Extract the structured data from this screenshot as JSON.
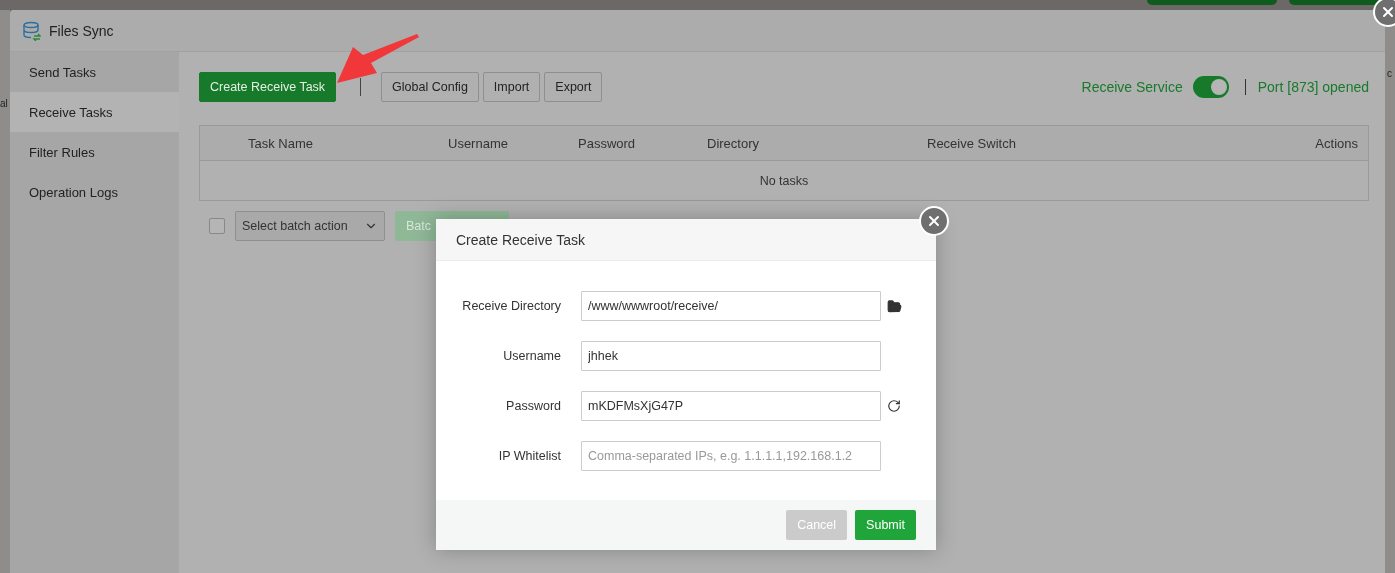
{
  "background": {
    "fragments": [
      "al",
      "c"
    ]
  },
  "window": {
    "title": "Files Sync"
  },
  "sidebar": {
    "items": [
      {
        "label": "Send Tasks",
        "selected": false
      },
      {
        "label": "Receive Tasks",
        "selected": true
      },
      {
        "label": "Filter Rules",
        "selected": false
      },
      {
        "label": "Operation Logs",
        "selected": false
      }
    ]
  },
  "toolbar": {
    "buttons": [
      {
        "label": "Create Receive Task",
        "kind": "primary"
      },
      {
        "label": "Global Config",
        "kind": "default"
      },
      {
        "label": "Import",
        "kind": "default"
      },
      {
        "label": "Export",
        "kind": "default"
      }
    ]
  },
  "service": {
    "label": "Receive Service",
    "on": true,
    "port_status": "Port [873] opened"
  },
  "table": {
    "columns": [
      "Task Name",
      "Username",
      "Password",
      "Directory",
      "Receive Switch",
      "Actions"
    ],
    "empty_text": "No tasks"
  },
  "batch": {
    "checked": false,
    "select_placeholder": "Select batch action",
    "button": "Batc"
  },
  "dialog": {
    "title": "Create Receive Task",
    "fields": [
      {
        "label": "Receive Directory",
        "value": "/www/wwwroot/receive/",
        "kind": "folder-picker"
      },
      {
        "label": "Username",
        "value": "jhhek",
        "kind": "text"
      },
      {
        "label": "Password",
        "value": "mKDFMsXjG47P",
        "kind": "generated"
      },
      {
        "label": "IP Whitelist",
        "placeholder": "Comma-separated IPs, e.g. 1.1.1.1,192.168.1.2",
        "kind": "text"
      }
    ],
    "buttons": [
      {
        "label": "Cancel",
        "kind": "secondary"
      },
      {
        "label": "Submit",
        "kind": "primary"
      }
    ]
  }
}
